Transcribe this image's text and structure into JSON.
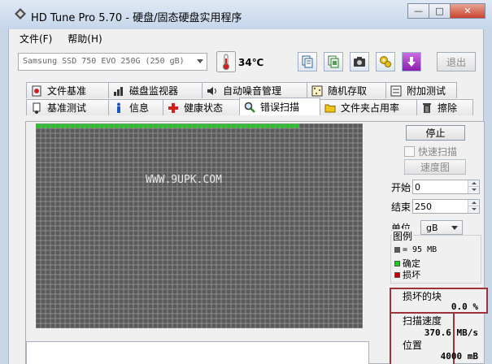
{
  "window": {
    "title": "HD Tune Pro 5.70 - 硬盘/固态硬盘实用程序",
    "minimize": "—",
    "maximize": "□",
    "close": "✕"
  },
  "menu": [
    "文件(F)",
    "帮助(H)"
  ],
  "toolbar": {
    "drive": "Samsung SSD 750 EVO 250G (250 gB)",
    "temperature": "34℃",
    "exit_label": "退出",
    "icons": [
      "copy-text-icon",
      "copy-screen-icon",
      "camera-icon",
      "options-icon",
      "save-arrow-icon"
    ]
  },
  "tabs_top": [
    {
      "label": "文件基准",
      "icon": "file-benchmark-icon"
    },
    {
      "label": "磁盘监视器",
      "icon": "disk-monitor-icon"
    },
    {
      "label": "自动噪音管理",
      "icon": "speaker-icon"
    },
    {
      "label": "随机存取",
      "icon": "random-access-icon"
    },
    {
      "label": "附加测试",
      "icon": "extra-tests-icon"
    }
  ],
  "tabs_bottom": [
    {
      "label": "基准测试",
      "icon": "benchmark-icon"
    },
    {
      "label": "信息",
      "icon": "info-icon"
    },
    {
      "label": "健康状态",
      "icon": "health-cross-icon"
    },
    {
      "label": "错误扫描",
      "icon": "magnifier-icon",
      "active": true
    },
    {
      "label": "文件夹占用率",
      "icon": "folder-icon"
    },
    {
      "label": "擦除",
      "icon": "trash-icon"
    }
  ],
  "scan": {
    "watermark": "WWW.9UPK.COM",
    "completed_fraction": 0.8,
    "colors": {
      "pending": "#5a5a5a",
      "ok": "#27c427",
      "damaged": "#c00000"
    }
  },
  "side": {
    "stop_label": "停止",
    "quick_scan_label": "快速扫描",
    "speed_map_label": "速度图",
    "start_label": "开始",
    "start_value": "0",
    "end_label": "结束",
    "end_value": "250",
    "unit_label": "单位",
    "unit_value": "gB",
    "legend_title": "图例",
    "legend_block": "= 95 MB",
    "legend_ok": "确定",
    "legend_bad": "损坏",
    "damaged_label": "损坏的块",
    "damaged_value": "0.0 %",
    "speed_label": "扫描速度",
    "speed_value": "370.6 MB/s",
    "position_label": "位置",
    "position_value": "4000 mB"
  }
}
